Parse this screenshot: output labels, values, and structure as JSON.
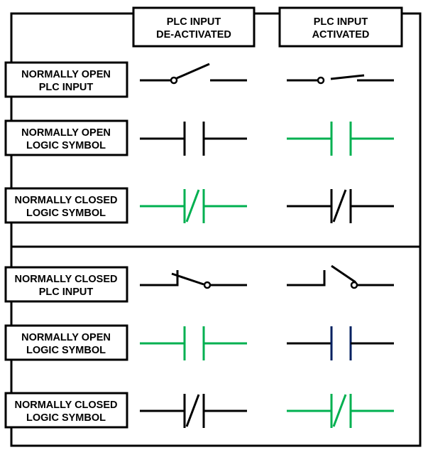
{
  "colors": {
    "inactive": "#000000",
    "energized": "#00b050",
    "navy": "#002060"
  },
  "columns": [
    {
      "id": "deactivated",
      "lines": [
        "PLC INPUT",
        "DE-ACTIVATED"
      ]
    },
    {
      "id": "activated",
      "lines": [
        "PLC INPUT",
        "ACTIVATED"
      ]
    }
  ],
  "sections": [
    {
      "name": "normally-open-input-section",
      "rows": [
        {
          "label": [
            "NORMALLY OPEN",
            "PLC INPUT"
          ],
          "symbol": "no-input",
          "deactivated": {
            "state": "open",
            "color": "inactive"
          },
          "activated": {
            "state": "closed",
            "color": "inactive"
          }
        },
        {
          "label": [
            "NORMALLY OPEN",
            "LOGIC SYMBOL"
          ],
          "symbol": "no-contact",
          "deactivated": {
            "state": "false",
            "color": "inactive"
          },
          "activated": {
            "state": "true",
            "color": "energized"
          }
        },
        {
          "label": [
            "NORMALLY CLOSED",
            "LOGIC SYMBOL"
          ],
          "symbol": "nc-contact",
          "deactivated": {
            "state": "true",
            "color": "energized"
          },
          "activated": {
            "state": "false",
            "color": "inactive"
          }
        }
      ]
    },
    {
      "name": "normally-closed-input-section",
      "rows": [
        {
          "label": [
            "NORMALLY CLOSED",
            "PLC INPUT"
          ],
          "symbol": "nc-input",
          "deactivated": {
            "state": "closed",
            "color": "inactive"
          },
          "activated": {
            "state": "open",
            "color": "inactive"
          }
        },
        {
          "label": [
            "NORMALLY OPEN",
            "LOGIC SYMBOL"
          ],
          "symbol": "no-contact",
          "deactivated": {
            "state": "true",
            "color": "energized"
          },
          "activated": {
            "state": "false",
            "color": "inactive",
            "plate_color": "navy"
          }
        },
        {
          "label": [
            "NORMALLY CLOSED",
            "LOGIC SYMBOL"
          ],
          "symbol": "nc-contact",
          "deactivated": {
            "state": "false",
            "color": "inactive"
          },
          "activated": {
            "state": "true",
            "color": "energized"
          }
        }
      ]
    }
  ]
}
